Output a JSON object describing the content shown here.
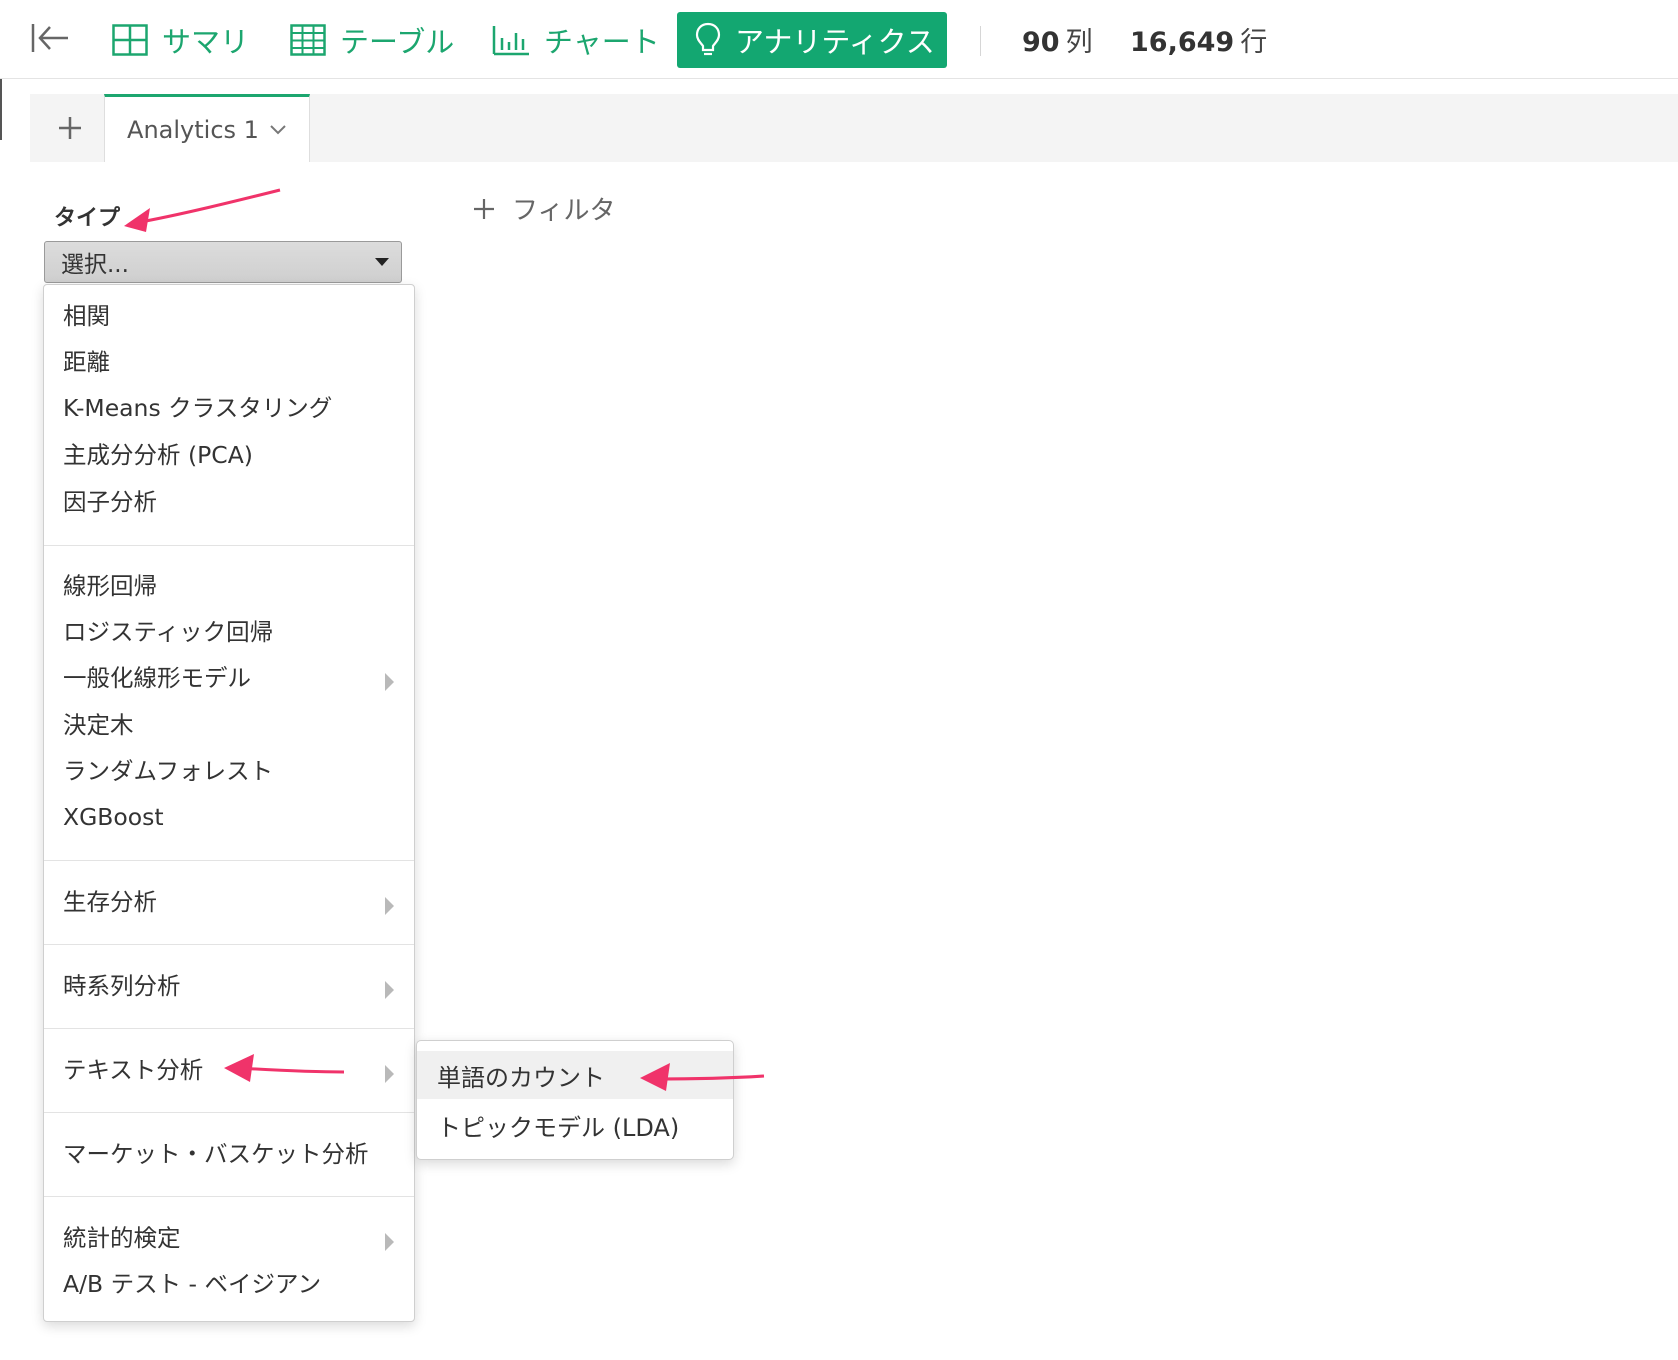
{
  "toolbar": {
    "nav": [
      {
        "label": "サマリ",
        "icon": "summary-grid-icon"
      },
      {
        "label": "テーブル",
        "icon": "table-grid-icon"
      },
      {
        "label": "チャート",
        "icon": "bar-chart-icon"
      },
      {
        "label": "アナリティクス",
        "icon": "lightbulb-icon",
        "active": true
      }
    ],
    "columns_count": "90",
    "columns_unit": "列",
    "rows_count": "16,649",
    "rows_unit": "行"
  },
  "tabs": {
    "active_tab": "Analytics 1"
  },
  "form": {
    "type_label": "タイプ",
    "select_value": "選択...",
    "filter_label": "フィルタ"
  },
  "menu": {
    "items": [
      {
        "label": "相関"
      },
      {
        "label": "距離"
      },
      {
        "label": "K-Means クラスタリング"
      },
      {
        "label": "主成分分析 (PCA)"
      },
      {
        "label": "因子分析"
      },
      {
        "label": "線形回帰"
      },
      {
        "label": "ロジスティック回帰"
      },
      {
        "label": "一般化線形モデル",
        "has_submenu": true
      },
      {
        "label": "決定木"
      },
      {
        "label": "ランダムフォレスト"
      },
      {
        "label": "XGBoost"
      },
      {
        "label": "生存分析",
        "has_submenu": true
      },
      {
        "label": "時系列分析",
        "has_submenu": true
      },
      {
        "label": "テキスト分析",
        "has_submenu": true
      },
      {
        "label": "マーケット・バスケット分析"
      },
      {
        "label": "統計的検定",
        "has_submenu": true
      },
      {
        "label": "A/B テスト - ベイジアン"
      }
    ]
  },
  "submenu": {
    "items": [
      {
        "label": "単語のカウント",
        "hovered": true
      },
      {
        "label": "トピックモデル (LDA)"
      }
    ]
  },
  "colors": {
    "accent": "#1ca66f",
    "active_bg": "#13a771",
    "annotation_arrow": "#f0336a"
  }
}
